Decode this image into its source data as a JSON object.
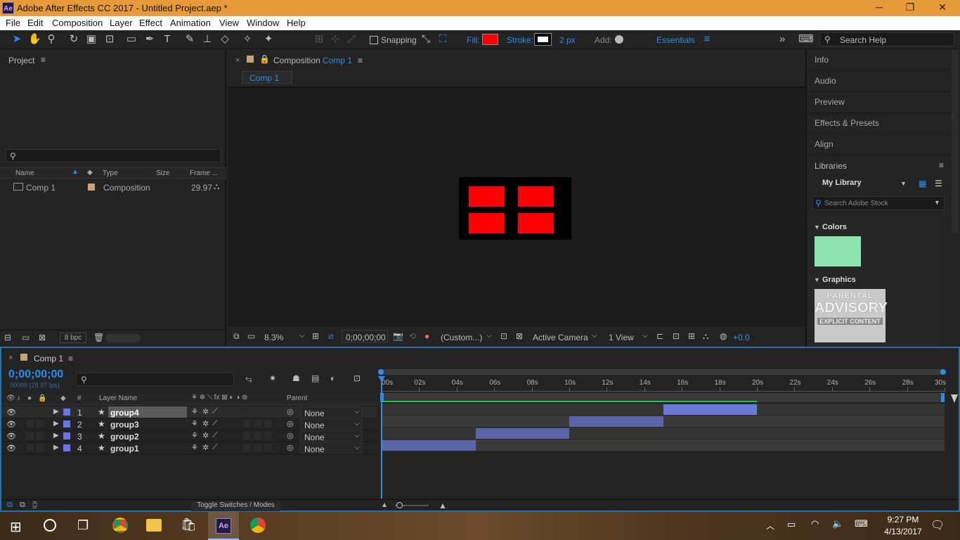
{
  "window": {
    "title": "Adobe After Effects CC 2017 - Untitled Project.aep *",
    "icon": "Ae",
    "min": "─",
    "max": "❐",
    "close": "✕"
  },
  "menu": [
    "File",
    "Edit",
    "Composition",
    "Layer",
    "Effect",
    "Animation",
    "View",
    "Window",
    "Help"
  ],
  "toolbar": {
    "snapping": "Snapping",
    "fill": "Fill:",
    "stroke": "Stroke:",
    "stroke_px": "2 px",
    "add": "Add:",
    "workspace": "Essentials",
    "more": "»",
    "search_help": "Search Help",
    "fill_color": "#ff0000"
  },
  "project": {
    "title": "Project",
    "search_placeholder": "",
    "columns": {
      "name": "Name",
      "type": "Type",
      "size": "Size",
      "frame": "Frame ..."
    },
    "items": [
      {
        "name": "Comp 1",
        "type": "Composition",
        "size": "",
        "frame": "29.97"
      }
    ],
    "bpc": "8 bpc"
  },
  "composition": {
    "tab_prefix": "Composition",
    "tab_name": "Comp 1",
    "subtab": "Comp 1",
    "zoom": "8.3%",
    "timecode": "0;00;00;00",
    "resolution": "(Custom...)",
    "camera": "Active Camera",
    "views": "1 View",
    "exposure": "+0.0"
  },
  "right_panels": [
    "Info",
    "Audio",
    "Preview",
    "Effects & Presets",
    "Align"
  ],
  "libraries": {
    "title": "Libraries",
    "library": "My Library",
    "search_placeholder": "Search Adobe Stock",
    "colors_label": "Colors",
    "swatch": "#8ee4b0",
    "graphics_label": "Graphics",
    "graphic_text_1": "PARENTAL",
    "graphic_text_2": "ADVISORY",
    "graphic_text_3": "EXPLICIT CONTENT"
  },
  "timeline": {
    "tab": "Comp 1",
    "timecode": "0;00;00;00",
    "fps": "00000 (29.97 fps)",
    "search_placeholder": "",
    "col_layer": "Layer Name",
    "col_parent": "Parent",
    "col_num": "#",
    "toggle": "Toggle Switches / Modes",
    "ticks": [
      "00s",
      "02s",
      "04s",
      "06s",
      "08s",
      "10s",
      "12s",
      "14s",
      "16s",
      "18s",
      "20s",
      "22s",
      "24s",
      "26s",
      "28s",
      "30s"
    ],
    "layers": [
      {
        "num": "1",
        "name": "group4",
        "parent": "None",
        "start": 15,
        "end": 20
      },
      {
        "num": "2",
        "name": "group3",
        "parent": "None",
        "start": 10,
        "end": 15
      },
      {
        "num": "3",
        "name": "group2",
        "parent": "None",
        "start": 5,
        "end": 10
      },
      {
        "num": "4",
        "name": "group1",
        "parent": "None",
        "start": 0,
        "end": 5
      }
    ]
  },
  "taskbar": {
    "time": "9:27 PM",
    "date": "4/13/2017"
  }
}
